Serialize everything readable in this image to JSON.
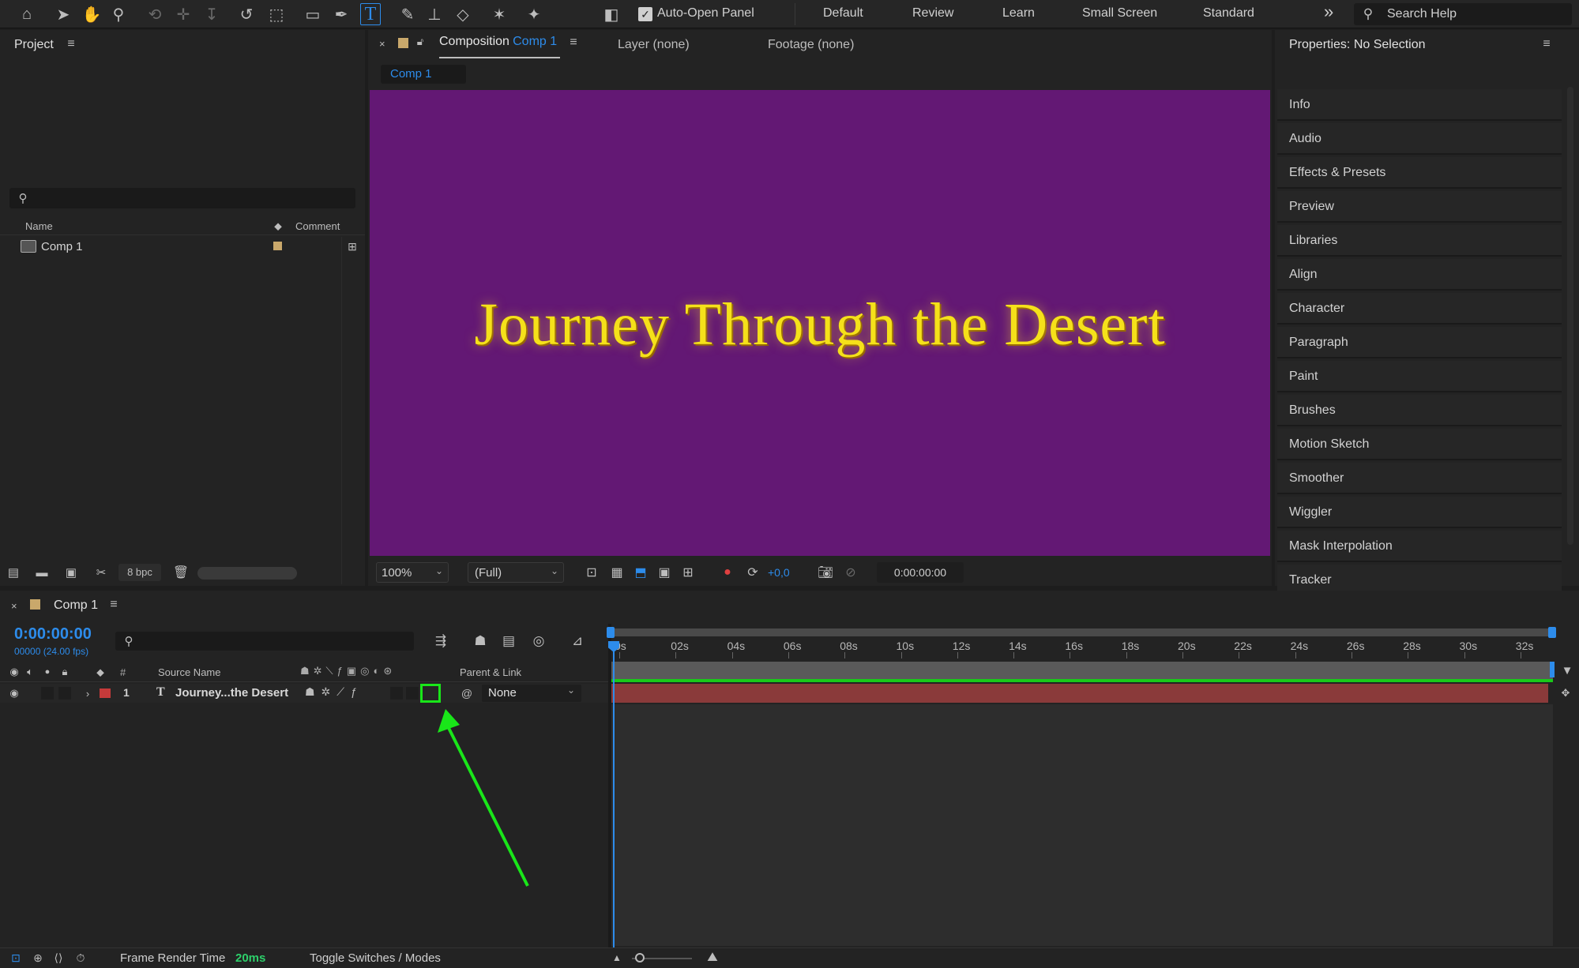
{
  "toolbar": {
    "auto_open_panel_label": "Auto-Open Panel",
    "workspaces": [
      "Default",
      "Review",
      "Learn",
      "Small Screen",
      "Standard"
    ],
    "more_label": "»",
    "search_placeholder": "Search Help"
  },
  "project": {
    "title": "Project",
    "columns": {
      "name": "Name",
      "comment": "Comment"
    },
    "items": [
      {
        "name": "Comp 1",
        "label_color": "#c9a86b"
      }
    ],
    "bit_depth": "8 bpc"
  },
  "viewer": {
    "tab_composition_prefix": "Composition",
    "tab_composition_name": "Comp 1",
    "tab_layer": "Layer (none)",
    "tab_footage": "Footage (none)",
    "breadcrumb": "Comp 1",
    "canvas_text": "Journey Through the Desert",
    "canvas_bg": "#631874",
    "text_color": "#f5e11a",
    "zoom": "100%",
    "resolution": "(Full)",
    "exposure": "+0,0",
    "timecode": "0:00:00:00"
  },
  "properties": {
    "title": "Properties: No Selection",
    "panels": [
      "Info",
      "Audio",
      "Effects & Presets",
      "Preview",
      "Libraries",
      "Align",
      "Character",
      "Paragraph",
      "Paint",
      "Brushes",
      "Motion Sketch",
      "Smoother",
      "Wiggler",
      "Mask Interpolation",
      "Tracker"
    ]
  },
  "timeline": {
    "comp_name": "Comp 1",
    "timecode": "0:00:00:00",
    "frame_info": "00000 (24.00 fps)",
    "columns": {
      "num": "#",
      "source_name": "Source Name",
      "parent": "Parent & Link"
    },
    "layers": [
      {
        "index": "1",
        "type_icon": "T",
        "name": "Journey...the Desert",
        "parent": "None",
        "label_color": "#c63a3a"
      }
    ],
    "ruler": [
      "0s",
      "02s",
      "04s",
      "06s",
      "08s",
      "10s",
      "12s",
      "14s",
      "16s",
      "18s",
      "20s",
      "22s",
      "24s",
      "26s",
      "28s",
      "30s",
      "32s"
    ],
    "layer_bar_color": "#8a3a3a"
  },
  "status": {
    "frame_render_label": "Frame Render Time",
    "frame_render_value": "20ms",
    "toggle_label": "Toggle Switches / Modes"
  },
  "annotation": {
    "highlight_color": "#19e619"
  }
}
